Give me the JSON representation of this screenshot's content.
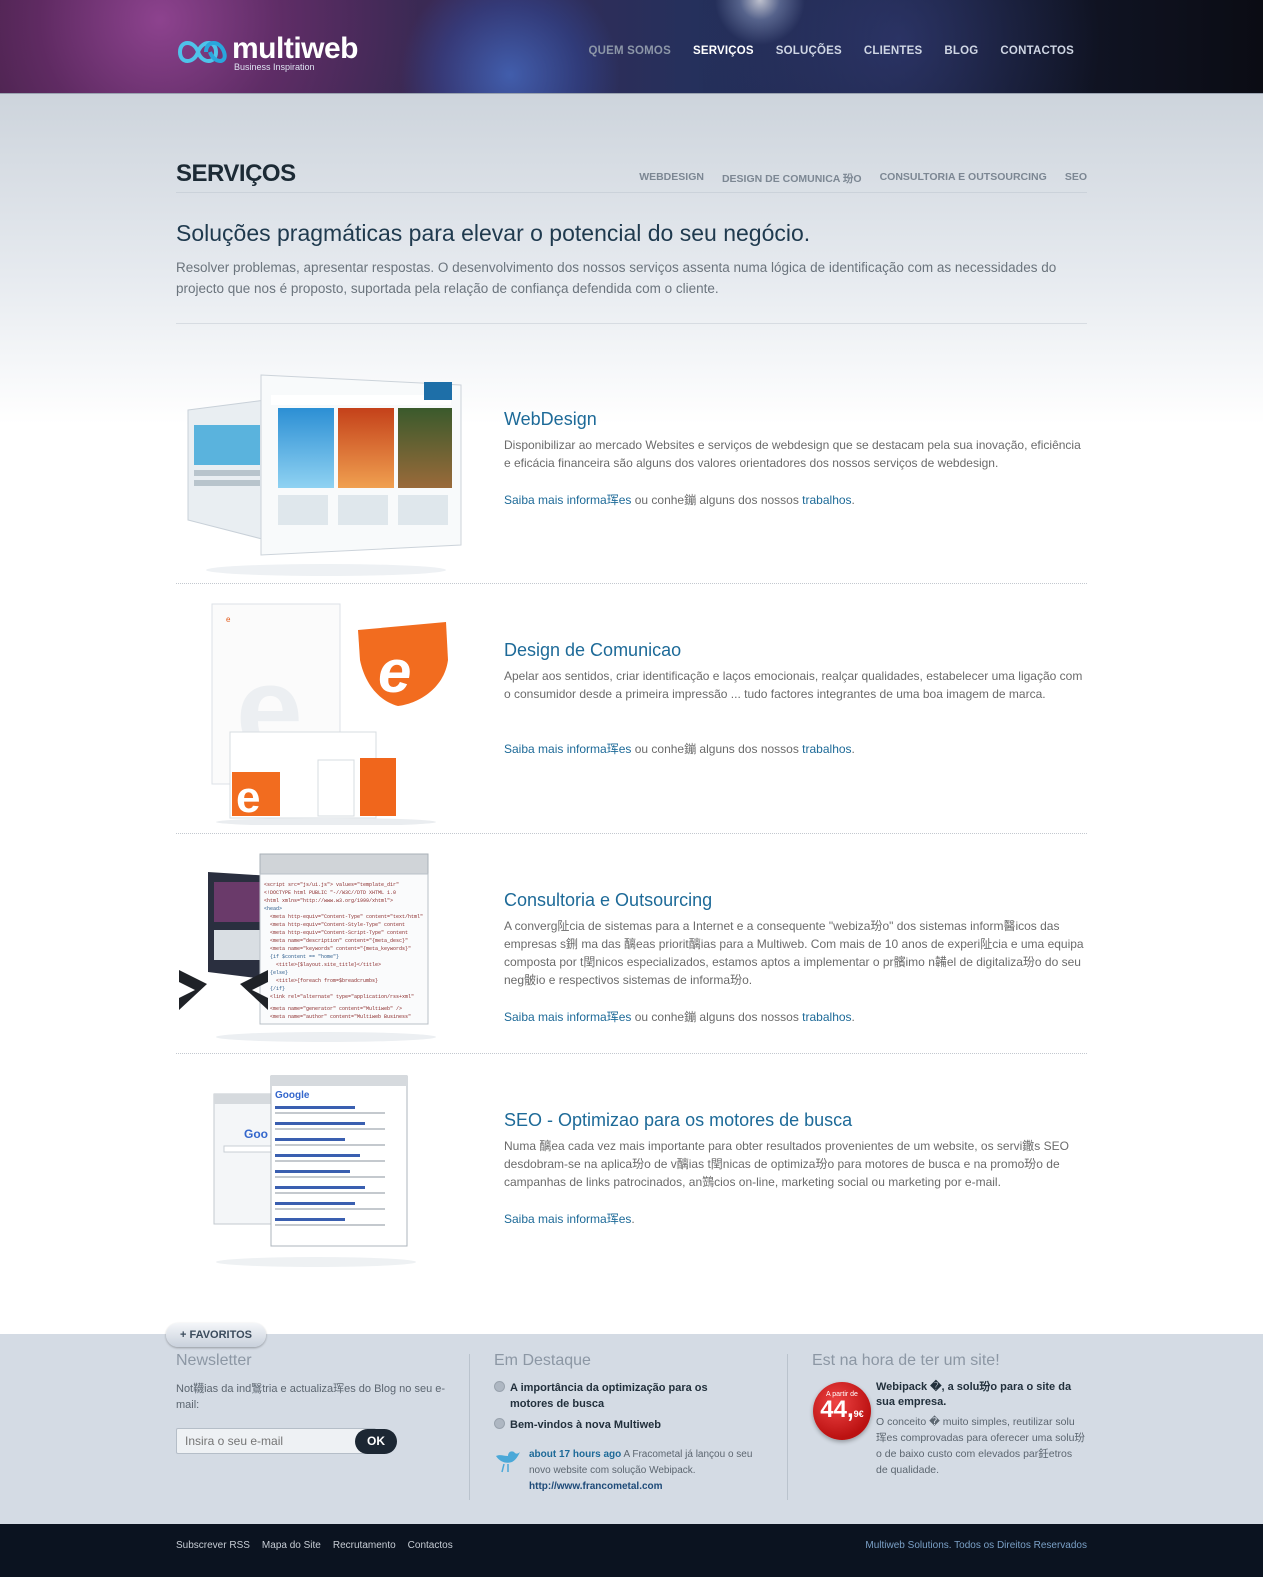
{
  "brand": {
    "name": "multiweb",
    "tagline": "Business Inspiration"
  },
  "nav": [
    {
      "label": "QUEM SOMOS"
    },
    {
      "label": "SERVIÇOS"
    },
    {
      "label": "SOLUÇÕES"
    },
    {
      "label": "CLIENTES"
    },
    {
      "label": "BLOG"
    },
    {
      "label": "CONTACTOS"
    }
  ],
  "page": {
    "title": "SERVIÇOS",
    "subnav": [
      "WEBDESIGN",
      "DESIGN DE COMUNICA 玢O",
      "CONSULTORIA E OUTSOURCING",
      "SEO"
    ],
    "headline": "Soluções pragmáticas para elevar o potencial do seu negócio.",
    "intro": "Resolver problemas, apresentar respostas. O desenvolvimento dos nossos serviços assenta numa lógica de identificação com as necessidades do projecto que nos é proposto, suportada pela relação de confiança defendida com o cliente."
  },
  "services": [
    {
      "title": "WebDesign",
      "desc": "Disponibilizar ao mercado Websites e serviços de webdesign que se destacam pela sua inovação, eficiência e eficácia financeira são alguns dos valores orientadores dos nossos serviços de webdesign.",
      "link1": "Saiba mais informa珲es",
      "mid": " ou conhe鏰 alguns dos nossos ",
      "link2": "trabalhos",
      "end": "."
    },
    {
      "title": "Design de Comunicao",
      "desc": "Apelar aos sentidos, criar identificação e laços emocionais, realçar qualidades, estabelecer uma ligação com o consumidor desde a primeira impressão ... tudo factores integrantes de uma boa imagem de marca.",
      "link1": "Saiba mais informa珲es",
      "mid": " ou conhe鏰 alguns dos nossos ",
      "link2": "trabalhos",
      "end": "."
    },
    {
      "title": "Consultoria e Outsourcing",
      "desc": "A converg阯cia de sistemas para a Internet e a consequente \"webiza玢o\" dos sistemas inform醫icos das empresas s鉶 ma das 醨eas priorit醨ias para a Multiweb. Com mais de 10 anos de experi阯cia e uma equipa composta por t閏nicos especializados, estamos aptos a implementar o pr髕imo n韛el de digitaliza玢o do seu neg骳io e respectivos sistemas de informa玢o.",
      "link1": "Saiba mais informa珲es",
      "mid": " ou conhe鏰 alguns dos nossos ",
      "link2": "trabalhos",
      "end": "."
    },
    {
      "title": "SEO - Optimizao para os motores de busca",
      "desc": "Numa 醨ea cada vez mais importante para obter resultados provenientes de um website, os servi鏾s SEO desdobram-se na aplica玢o de v醨ias t閏nicas de optimiza玢o para motores de busca e na promo玢o de campanhas de links patrocinados, an鷑cios on-line, marketing social ou marketing por e-mail.",
      "link1": "Saiba mais informa珲es",
      "mid": "",
      "link2": "",
      "end": "."
    }
  ],
  "footer": {
    "favoritos": "+ FAVORITOS",
    "newsletter": {
      "title": "Newsletter",
      "text": "Not韈ias da ind鷖tria e actualiza珲es do Blog no seu e-mail:",
      "placeholder": "Insira o seu e-mail",
      "button": "OK"
    },
    "destaque": {
      "title": "Em Destaque",
      "items": [
        "A importância da optimização para os motores de busca",
        "Bem-vindos à nova Multiweb"
      ],
      "tweet_time": "about 17 hours ago",
      "tweet_text": " A Fracometal já lançou o seu novo website com solução Webipack.",
      "tweet_url": "http://www.francometal.com"
    },
    "promo": {
      "title": "Est na hora de ter um site!",
      "badge_small": "A partir de",
      "badge_price": "44,",
      "badge_cents": "9€",
      "headline": "Webipack �, a solu玢o para o site da sua empresa.",
      "text1": "O conceito � muito simples, reutilizar solu",
      "text2": "珲es comprovadas para oferecer uma solu玢o de baixo custo com elevados par鈓etros de qualidade."
    }
  },
  "bottom": {
    "links": [
      "Subscrever RSS",
      "Mapa do Site",
      "Recrutamento",
      "Contactos"
    ],
    "copyright": "Multiweb Solutions. Todos os Direitos Reservados"
  },
  "colors": {
    "accent": "#1d6a98",
    "dark": "#0b1320",
    "footer_panel": "#d4dbe4"
  }
}
